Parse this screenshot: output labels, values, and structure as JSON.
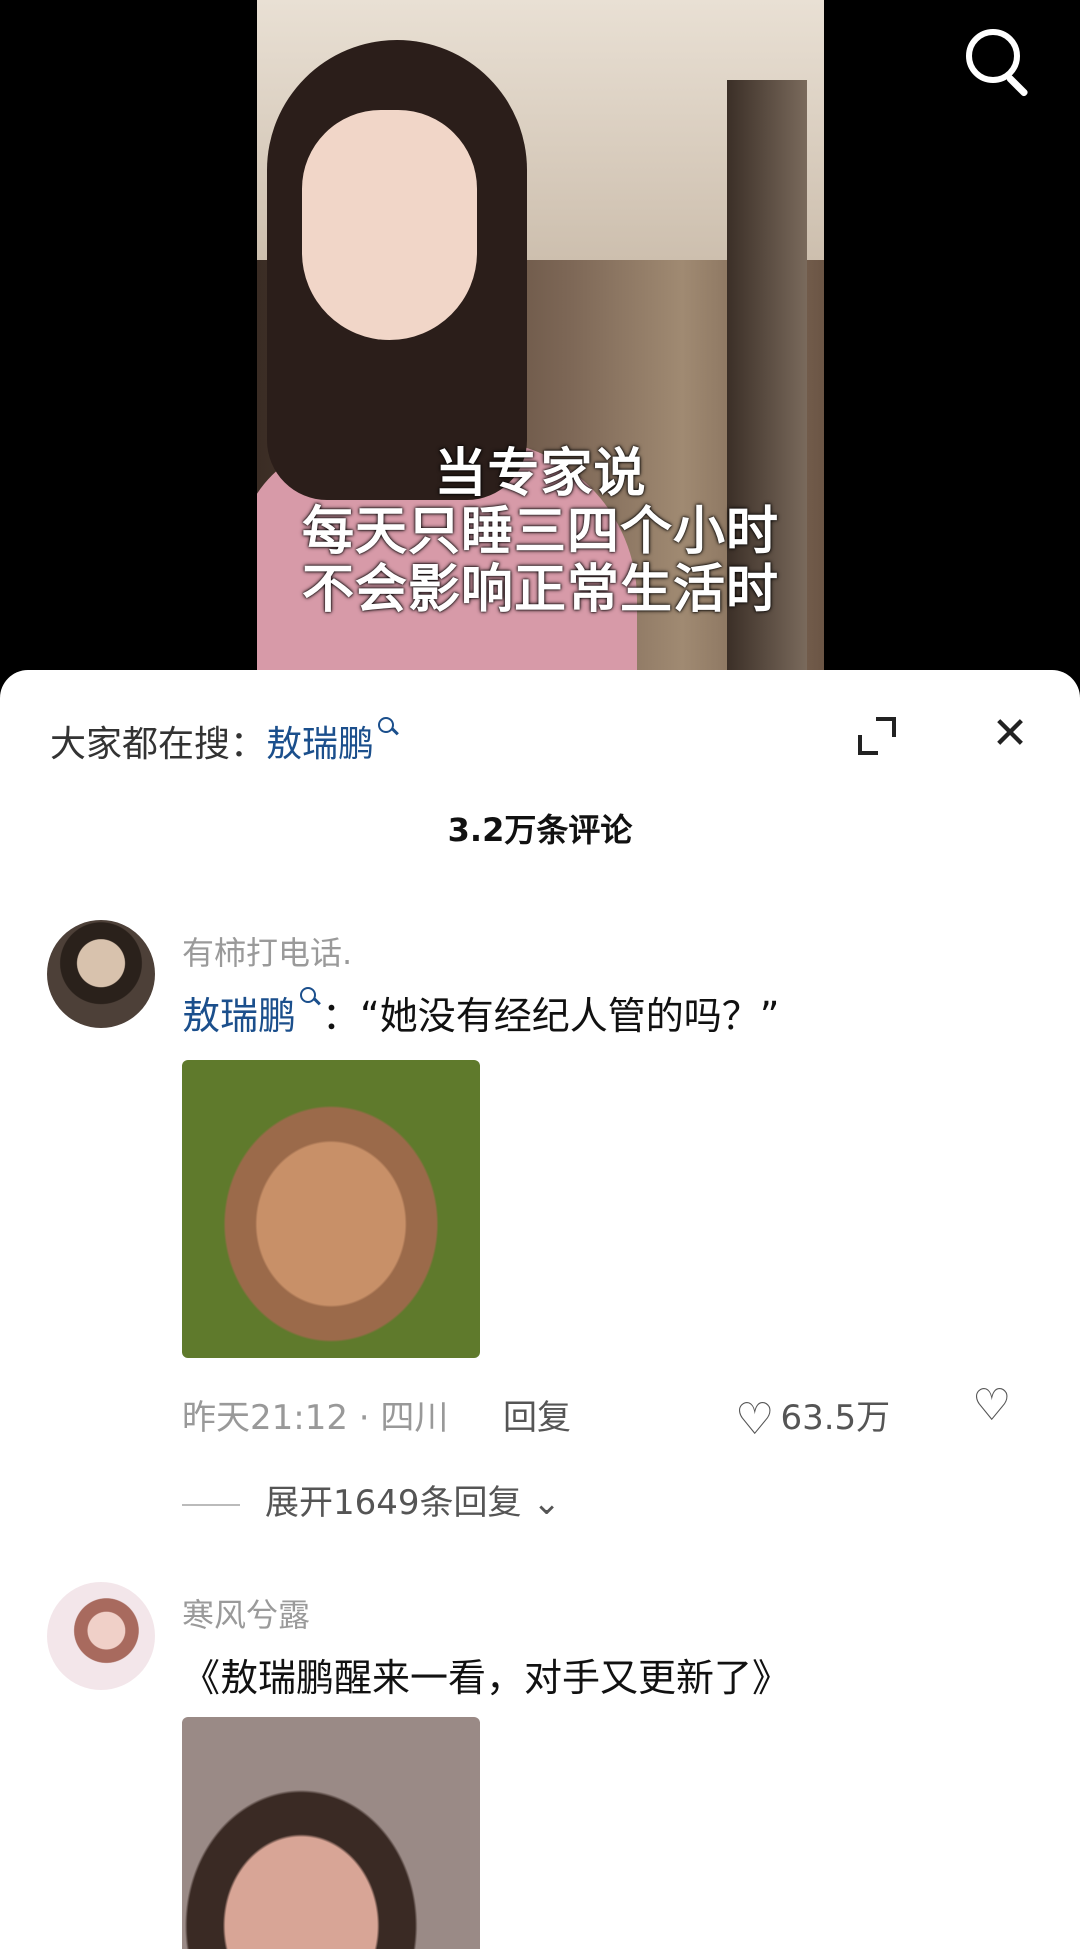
{
  "video": {
    "caption_lines": [
      "当专家说",
      "每天只睡三四个小时",
      "不会影响正常生活时"
    ]
  },
  "icons": {
    "search": "search-icon",
    "expand": "expand-icon",
    "close": "close-icon",
    "like": "heart-icon",
    "dislike": "broken-heart-icon",
    "chevron": "chevron-down-icon"
  },
  "sheet": {
    "hot_search_label": "大家都在搜：",
    "hot_search_term": "敖瑞鹏",
    "close_glyph": "✕",
    "comment_count": "3.2万条评论"
  },
  "comments": [
    {
      "username": "有柿打电话.",
      "text_link": "敖瑞鹏",
      "text_rest": "：“她没有经纪人管的吗？”",
      "meta": "昨天21:12 · 四川",
      "reply_label": "回复",
      "likes": "63.5万",
      "expand_replies": "展开1649条回复"
    },
    {
      "username": "寒风兮露",
      "text": "《敖瑞鹏醒来一看，对手又更新了》"
    }
  ],
  "colors": {
    "link": "#1b4f8c",
    "background": "#ffffff"
  }
}
